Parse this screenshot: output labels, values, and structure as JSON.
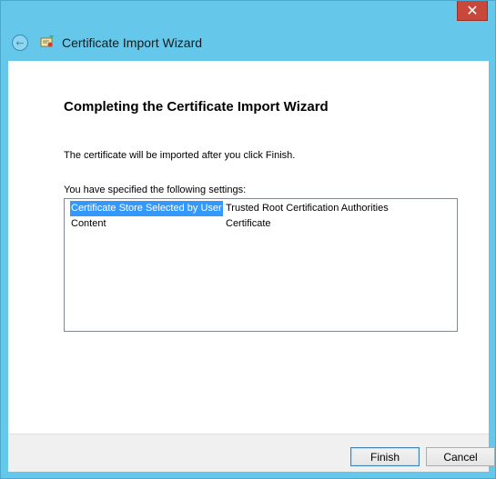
{
  "window": {
    "title": "Certificate Import Wizard",
    "close_glyph": "✕"
  },
  "titlebar": {
    "back_glyph": "←"
  },
  "page": {
    "heading": "Completing the Certificate Import Wizard",
    "info": "The certificate will be imported after you click Finish.",
    "settings_label": "You have specified the following settings:",
    "settings": [
      {
        "key": "Certificate Store Selected by User",
        "value": "Trusted Root Certification Authorities",
        "selected": true
      },
      {
        "key": "Content",
        "value": "Certificate",
        "selected": false
      }
    ]
  },
  "footer": {
    "finish_label": "Finish",
    "cancel_label": "Cancel"
  },
  "colors": {
    "frame": "#65c8eb",
    "close": "#c9483c",
    "selection": "#3399ff"
  }
}
